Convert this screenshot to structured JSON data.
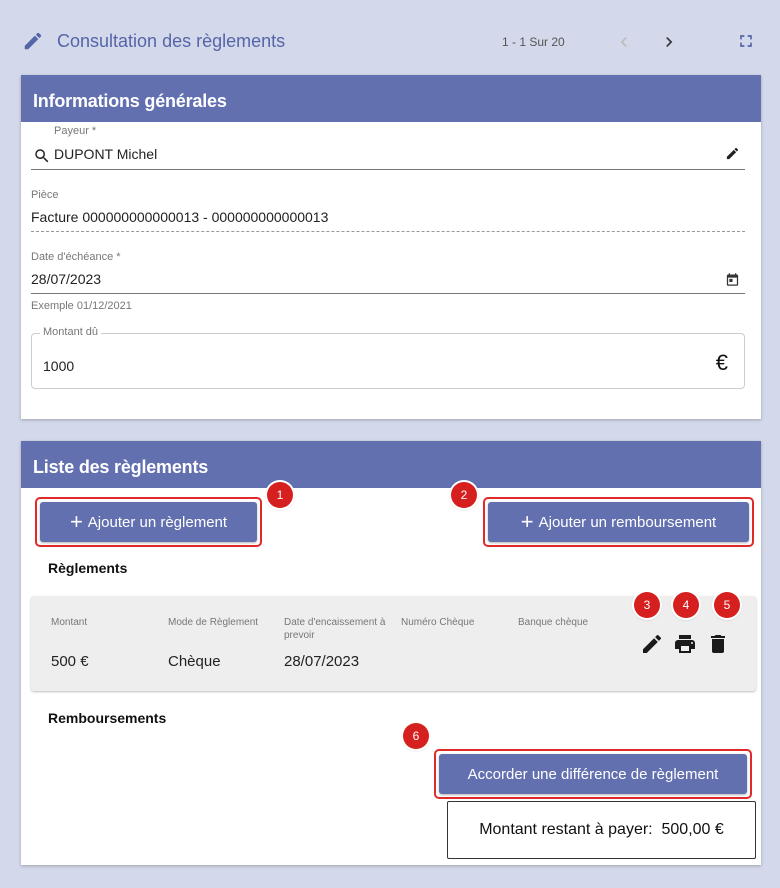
{
  "header": {
    "title": "Consultation des règlements",
    "pager": "1 - 1 Sur 20"
  },
  "info": {
    "title": "Informations générales",
    "payeur_label": "Payeur *",
    "payeur_value": "DUPONT Michel",
    "piece_label": "Pièce",
    "piece_value": "Facture 000000000000013 - 000000000000013",
    "date_label": "Date d'échéance *",
    "date_value": "28/07/2023",
    "date_hint": "Exemple 01/12/2021",
    "montant_label": "Montant dû",
    "montant_value": "1000",
    "currency": "€"
  },
  "reglements": {
    "title": "Liste des règlements",
    "add_reglement": "Ajouter un règlement",
    "add_remboursement": "Ajouter un remboursement",
    "section_reglements": "Règlements",
    "columns": [
      "Montant",
      "Mode de Règlement",
      "Date d'encaissement à prevoir",
      "Numéro Chèque",
      "Banque chèque"
    ],
    "row": {
      "montant": "500 €",
      "mode": "Chèque",
      "date": "28/07/2023",
      "numero": "",
      "banque": ""
    },
    "section_remboursements": "Remboursements",
    "accorder": "Accorder une différence de règlement",
    "restant": "Montant restant à payer:  500,00 €"
  },
  "badges": [
    "1",
    "2",
    "3",
    "4",
    "5",
    "6"
  ],
  "colors": {
    "accent": "#6370b0",
    "background": "#d3d8ea",
    "highlight": "#e02a2a"
  }
}
